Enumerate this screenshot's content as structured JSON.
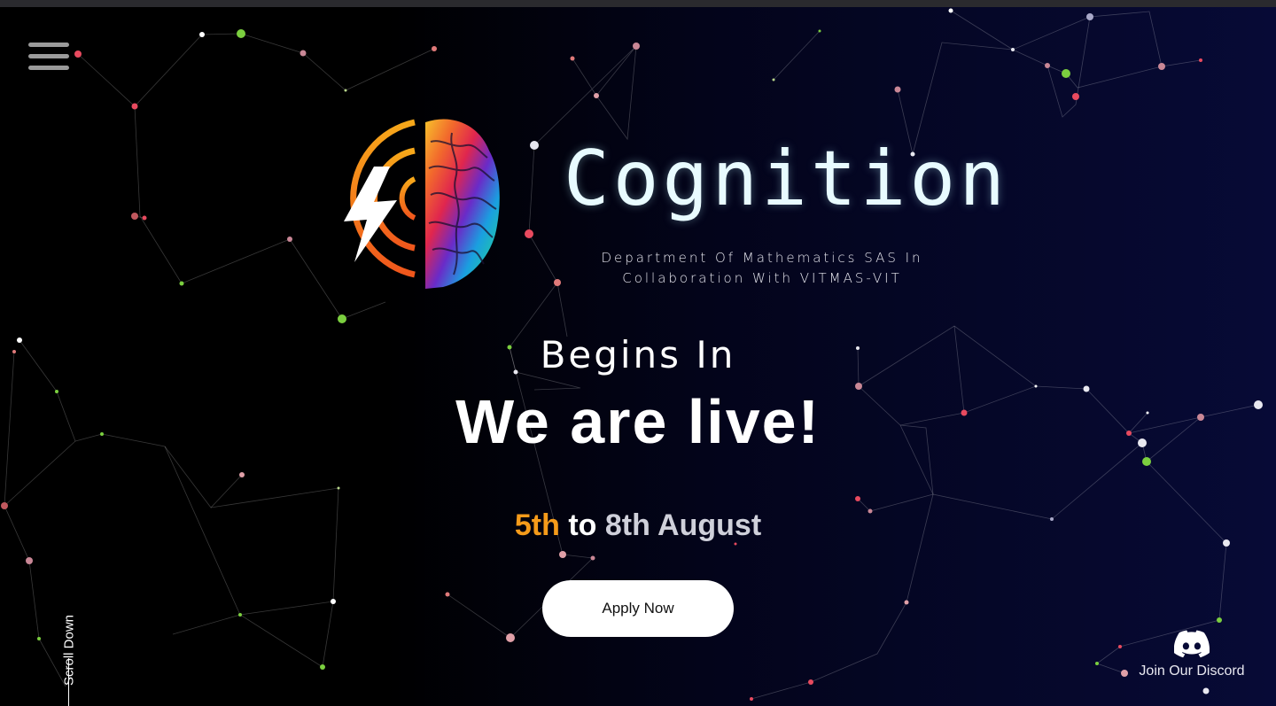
{
  "header": {
    "menu_icon": "hamburger-menu-icon"
  },
  "hero": {
    "title": "Cognition",
    "subtitle_line1": "Department Of Mathematics SAS In",
    "subtitle_line2": "Collaboration With VITMAS-VIT",
    "begins_label": "Begins In",
    "status": "We are live!",
    "date_start": "5th",
    "date_connector": "to",
    "date_end": "8th August",
    "apply_label": "Apply Now"
  },
  "scroll": {
    "label": "Scroll Down"
  },
  "discord": {
    "icon": "discord-icon",
    "label": "Join Our Discord"
  },
  "colors": {
    "accent_orange": "#f59b1a",
    "background_dark": "#000000",
    "background_navy": "#070a36",
    "button_bg": "#ffffff"
  }
}
